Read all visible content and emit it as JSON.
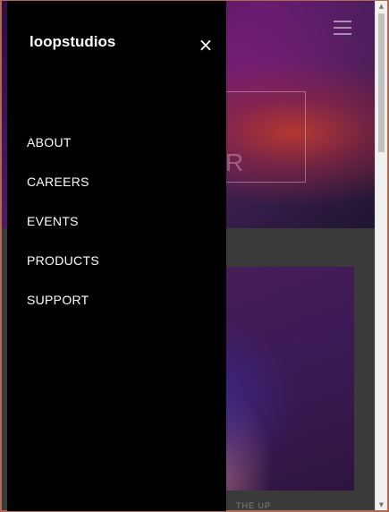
{
  "drawer": {
    "logo": "loopstudios",
    "close_glyph": "×",
    "menu": [
      "ABOUT",
      "CAREERS",
      "EVENTS",
      "PRODUCTS",
      "SUPPORT"
    ]
  },
  "hero": {
    "box_text_fragment": "R"
  },
  "content": {
    "card_caption_fragment": "THE UP"
  },
  "icons": {
    "hamburger": "hamburger-icon",
    "close": "close-icon"
  },
  "colors": {
    "drawer_bg": "#000000",
    "text": "#ffffff",
    "page_bg": "#3a3a3a",
    "frame": "#b06a52"
  }
}
